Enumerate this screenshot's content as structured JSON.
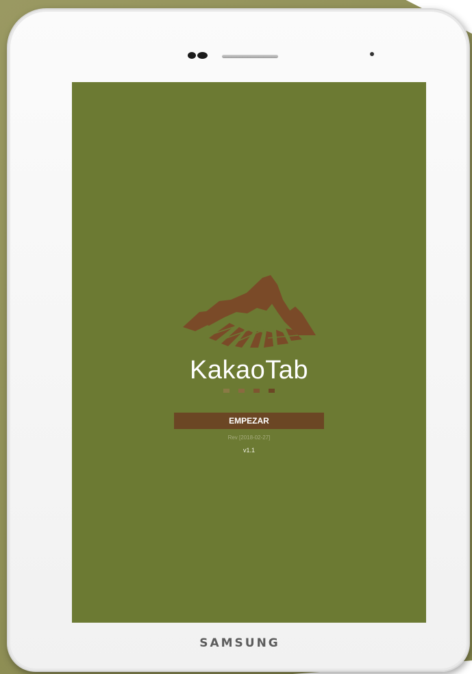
{
  "device": {
    "brand": "SAMSUNG"
  },
  "app": {
    "title": "KakaoTab",
    "start_button_label": "EMPEZAR",
    "revision": "Rev [2018-02-27]",
    "version": "v1.1"
  },
  "colors": {
    "screen_background": "#6c7a33",
    "accent_brown": "#6b4624",
    "logo_brown": "#7a4a28"
  },
  "icons": {
    "logo": "mountain-logo-icon",
    "pagination": "loading-dots-icon"
  }
}
